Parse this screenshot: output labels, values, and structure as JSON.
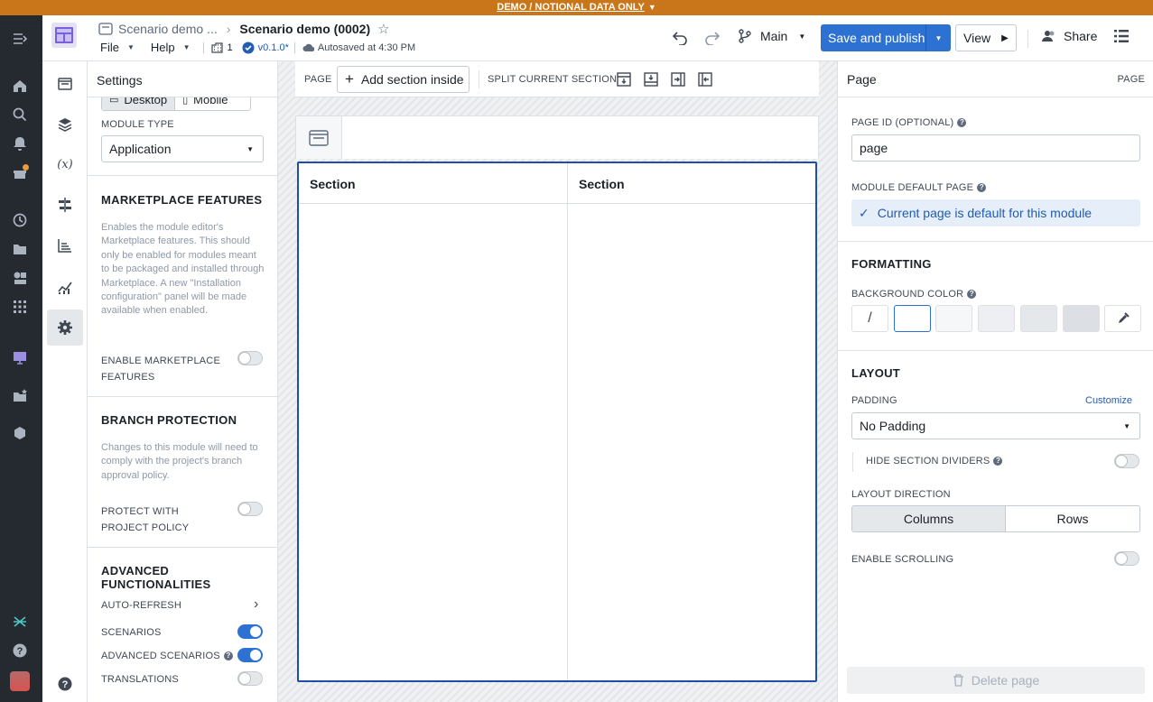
{
  "banner": {
    "text": "DEMO / NOTIONAL DATA ONLY"
  },
  "header": {
    "breadcrumb_parent": "Scenario demo ...",
    "title": "Scenario demo (0002)",
    "menu_file": "File",
    "menu_help": "Help",
    "branch_count": "1",
    "version": "v0.1.0*",
    "autosave": "Autosaved at 4:30 PM",
    "branch_name": "Main",
    "save_label": "Save and publish",
    "view_label": "View",
    "share_label": "Share"
  },
  "settings": {
    "title": "Settings",
    "layout_desktop": "Desktop",
    "layout_mobile": "Mobile",
    "module_type_label": "MODULE TYPE",
    "module_type_value": "Application",
    "marketplace_title": "MARKETPLACE FEATURES",
    "marketplace_desc": "Enables the module editor's Marketplace features. This should only be enabled for modules meant to be packaged and installed through Marketplace. A new \"Installation configuration\" panel will be made available when enabled.",
    "enable_marketplace_label": "ENABLE MARKETPLACE FEATURES",
    "branch_title": "BRANCH PROTECTION",
    "branch_desc": "Changes to this module will need to comply with the project's branch approval policy.",
    "protect_label": "PROTECT WITH PROJECT POLICY",
    "advanced_title": "ADVANCED FUNCTIONALITIES",
    "auto_refresh_label": "AUTO-REFRESH",
    "scenarios_label": "SCENARIOS",
    "advanced_scenarios_label": "ADVANCED SCENARIOS",
    "translations_label": "TRANSLATIONS",
    "toggles": {
      "enable_marketplace": false,
      "protect": false,
      "scenarios": true,
      "advanced_scenarios": true,
      "translations": false
    }
  },
  "canvas": {
    "page_label": "PAGE",
    "add_section_label": "Add section inside",
    "split_label": "SPLIT CURRENT SECTION",
    "sections": [
      "Section",
      "Section"
    ]
  },
  "page_panel": {
    "title": "Page",
    "title_right": "PAGE",
    "page_id_label": "PAGE ID (OPTIONAL)",
    "page_id_value": "page",
    "default_label": "MODULE DEFAULT PAGE",
    "default_value": "Current page is default for this module",
    "formatting_title": "FORMATTING",
    "bg_color_label": "BACKGROUND COLOR",
    "swatches": [
      "#ffffff",
      "#f6f7f9",
      "#edeff2",
      "#e5e8eb",
      "#dce0e5"
    ],
    "layout_title": "LAYOUT",
    "padding_label": "PADDING",
    "customize_label": "Customize",
    "padding_value": "No Padding",
    "hide_dividers_label": "HIDE SECTION DIVIDERS",
    "direction_label": "LAYOUT DIRECTION",
    "direction_columns": "Columns",
    "direction_rows": "Rows",
    "scrolling_label": "ENABLE SCROLLING",
    "delete_label": "Delete page"
  },
  "colors": {
    "accent": "#2d72d2",
    "banner": "#c87619",
    "nav": "#252a31",
    "selection": "#1f4ea8"
  }
}
